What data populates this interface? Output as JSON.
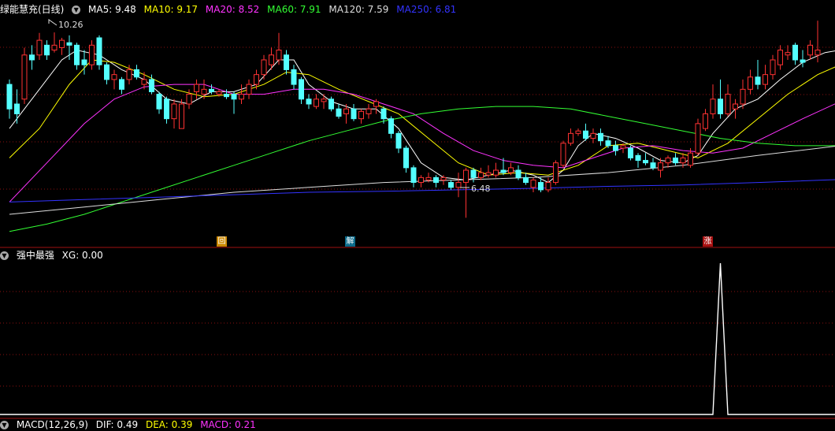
{
  "header": {
    "stock_name": "绿能慧充(日线)",
    "ma": [
      {
        "label": "MA5: 9.48",
        "color": "#ffffff"
      },
      {
        "label": "MA10: 9.17",
        "color": "#ffff00"
      },
      {
        "label": "MA20: 8.52",
        "color": "#ff33ff"
      },
      {
        "label": "MA60: 7.91",
        "color": "#33ff33"
      },
      {
        "label": "MA120: 7.59",
        "color": "#dddddd"
      },
      {
        "label": "MA250: 6.81",
        "color": "#3333ff"
      }
    ]
  },
  "markers": {
    "hui": "回",
    "jie": "解",
    "zhang": "涨"
  },
  "indicator": {
    "title": "强中最强",
    "xg_label": "XG: 0.00"
  },
  "macd": {
    "title": "MACD(12,26,9)",
    "dif": "DIF: 0.49",
    "dea": "DEA: 0.39",
    "macd": "MACD: 0.21"
  },
  "chart_data": {
    "type": "candlestick",
    "price_range": [
      6.1,
      10.6
    ],
    "annotations": {
      "high": "10.26",
      "low": "6.48"
    },
    "candles": [
      [
        9.2,
        8.7,
        9.3,
        8.5
      ],
      [
        8.8,
        8.6,
        9.1,
        8.4
      ],
      [
        8.9,
        9.8,
        9.95,
        8.8
      ],
      [
        9.8,
        9.7,
        10.0,
        9.5
      ],
      [
        9.8,
        10.1,
        10.25,
        9.7
      ],
      [
        10.0,
        9.8,
        10.1,
        9.7
      ],
      [
        9.9,
        10.0,
        10.26,
        9.85
      ],
      [
        9.95,
        10.1,
        10.15,
        9.8
      ],
      [
        10.05,
        10.0,
        10.2,
        9.7
      ],
      [
        10.0,
        9.6,
        10.05,
        9.5
      ],
      [
        9.7,
        9.6,
        9.9,
        9.4
      ],
      [
        9.6,
        10.0,
        10.1,
        9.5
      ],
      [
        10.15,
        9.6,
        10.2,
        9.5
      ],
      [
        9.6,
        9.3,
        9.65,
        9.2
      ],
      [
        9.3,
        9.4,
        9.5,
        9.1
      ],
      [
        9.3,
        9.1,
        9.35,
        9.0
      ],
      [
        9.3,
        9.5,
        9.6,
        9.2
      ],
      [
        9.5,
        9.35,
        9.6,
        9.3
      ],
      [
        9.2,
        9.3,
        9.45,
        9.1
      ],
      [
        9.3,
        9.05,
        9.4,
        9.0
      ],
      [
        9.0,
        8.7,
        9.05,
        8.6
      ],
      [
        8.9,
        8.5,
        8.95,
        8.4
      ],
      [
        8.5,
        8.8,
        8.9,
        8.3
      ],
      [
        8.3,
        8.8,
        8.9,
        8.3
      ],
      [
        8.8,
        9.0,
        9.1,
        8.7
      ],
      [
        9.05,
        9.2,
        9.3,
        8.9
      ],
      [
        9.0,
        9.1,
        9.3,
        8.9
      ],
      [
        9.1,
        9.05,
        9.2,
        9.0
      ],
      [
        9.0,
        9.05,
        9.1,
        8.95
      ],
      [
        9.0,
        8.95,
        9.1,
        8.9
      ],
      [
        9.0,
        8.9,
        9.05,
        8.6
      ],
      [
        8.9,
        9.0,
        9.2,
        8.8
      ],
      [
        9.0,
        9.2,
        9.3,
        8.9
      ],
      [
        9.2,
        9.4,
        9.5,
        9.1
      ],
      [
        9.4,
        9.7,
        9.8,
        9.3
      ],
      [
        9.6,
        9.8,
        9.95,
        9.5
      ],
      [
        9.7,
        9.9,
        10.25,
        9.6
      ],
      [
        9.8,
        9.5,
        9.9,
        9.4
      ],
      [
        9.5,
        9.2,
        9.6,
        9.1
      ],
      [
        9.3,
        8.9,
        9.35,
        8.8
      ],
      [
        8.9,
        8.8,
        9.0,
        8.7
      ],
      [
        8.75,
        8.9,
        9.0,
        8.7
      ],
      [
        8.85,
        8.9,
        9.0,
        8.7
      ],
      [
        8.9,
        8.7,
        8.95,
        8.65
      ],
      [
        8.7,
        8.55,
        8.8,
        8.5
      ],
      [
        8.6,
        8.7,
        8.8,
        8.4
      ],
      [
        8.7,
        8.5,
        8.8,
        8.45
      ],
      [
        8.5,
        8.65,
        8.7,
        8.4
      ],
      [
        8.6,
        8.7,
        8.8,
        8.5
      ],
      [
        8.75,
        8.85,
        8.9,
        8.6
      ],
      [
        8.7,
        8.5,
        8.75,
        8.4
      ],
      [
        8.5,
        8.2,
        8.55,
        8.1
      ],
      [
        8.2,
        7.9,
        8.25,
        7.8
      ],
      [
        7.9,
        7.5,
        7.95,
        7.4
      ],
      [
        7.5,
        7.2,
        7.55,
        7.1
      ],
      [
        7.2,
        7.3,
        7.35,
        7.1
      ],
      [
        7.25,
        7.3,
        7.4,
        7.2
      ],
      [
        7.3,
        7.2,
        7.35,
        7.1
      ],
      [
        7.25,
        7.3,
        7.35,
        7.15
      ],
      [
        7.2,
        7.1,
        7.25,
        7.05
      ],
      [
        7.1,
        7.2,
        7.4,
        6.9
      ],
      [
        7.2,
        7.45,
        7.5,
        6.48
      ],
      [
        7.45,
        7.3,
        7.5,
        7.2
      ],
      [
        7.3,
        7.4,
        7.5,
        7.25
      ],
      [
        7.35,
        7.4,
        7.55,
        7.3
      ],
      [
        7.35,
        7.45,
        7.6,
        7.3
      ],
      [
        7.45,
        7.4,
        7.7,
        7.35
      ],
      [
        7.4,
        7.5,
        7.6,
        7.35
      ],
      [
        7.45,
        7.3,
        7.55,
        7.25
      ],
      [
        7.3,
        7.2,
        7.4,
        7.15
      ],
      [
        7.1,
        7.25,
        7.3,
        7.0
      ],
      [
        7.2,
        7.05,
        7.3,
        7.0
      ],
      [
        7.05,
        7.2,
        7.3,
        7.0
      ],
      [
        7.2,
        7.6,
        7.65,
        7.15
      ],
      [
        7.55,
        8.0,
        8.05,
        7.5
      ],
      [
        8.0,
        8.2,
        8.3,
        7.95
      ],
      [
        8.2,
        8.25,
        8.3,
        8.15
      ],
      [
        8.25,
        8.1,
        8.4,
        8.05
      ],
      [
        8.1,
        8.2,
        8.3,
        8.0
      ],
      [
        8.2,
        8.05,
        8.3,
        7.95
      ],
      [
        8.05,
        7.95,
        8.15,
        7.9
      ],
      [
        7.95,
        7.85,
        8.05,
        7.75
      ],
      [
        7.9,
        7.95,
        8.0,
        7.8
      ],
      [
        7.9,
        7.7,
        7.95,
        7.65
      ],
      [
        7.75,
        7.65,
        7.8,
        7.5
      ],
      [
        7.65,
        7.6,
        7.8,
        7.55
      ],
      [
        7.6,
        7.5,
        7.7,
        7.45
      ],
      [
        7.45,
        7.6,
        7.7,
        7.3
      ],
      [
        7.6,
        7.7,
        7.75,
        7.5
      ],
      [
        7.7,
        7.6,
        7.8,
        7.55
      ],
      [
        7.6,
        7.7,
        7.8,
        7.5
      ],
      [
        7.55,
        7.8,
        7.9,
        7.5
      ],
      [
        7.8,
        8.4,
        8.5,
        7.75
      ],
      [
        8.3,
        8.6,
        8.7,
        8.25
      ],
      [
        8.6,
        8.9,
        9.2,
        8.5
      ],
      [
        8.9,
        8.6,
        9.3,
        8.5
      ],
      [
        8.6,
        9.0,
        9.2,
        8.55
      ],
      [
        8.7,
        8.8,
        8.9,
        8.5
      ],
      [
        8.8,
        9.1,
        9.3,
        8.7
      ],
      [
        9.1,
        9.35,
        9.5,
        9.0
      ],
      [
        9.35,
        9.2,
        9.7,
        9.1
      ],
      [
        9.2,
        9.4,
        9.6,
        9.1
      ],
      [
        9.4,
        9.7,
        9.8,
        9.3
      ],
      [
        9.6,
        9.9,
        10.0,
        9.5
      ],
      [
        9.8,
        9.85,
        10.0,
        9.7
      ],
      [
        10.0,
        9.7,
        10.05,
        9.6
      ],
      [
        9.7,
        9.65,
        9.9,
        9.55
      ],
      [
        9.8,
        10.0,
        10.1,
        9.7
      ],
      [
        9.8,
        9.9,
        10.5,
        9.65
      ]
    ],
    "ma_lines": [
      {
        "name": "MA5",
        "color": "#ffffff",
        "points": [
          [
            0,
            8.3
          ],
          [
            3,
            8.9
          ],
          [
            7,
            9.7
          ],
          [
            9,
            9.9
          ],
          [
            12,
            9.8
          ],
          [
            15,
            9.5
          ],
          [
            18,
            9.3
          ],
          [
            21,
            8.9
          ],
          [
            24,
            8.8
          ],
          [
            27,
            9.05
          ],
          [
            30,
            9.05
          ],
          [
            33,
            9.2
          ],
          [
            36,
            9.7
          ],
          [
            38,
            9.7
          ],
          [
            40,
            9.2
          ],
          [
            43,
            8.85
          ],
          [
            46,
            8.7
          ],
          [
            49,
            8.7
          ],
          [
            52,
            8.3
          ],
          [
            55,
            7.6
          ],
          [
            58,
            7.3
          ],
          [
            61,
            7.25
          ],
          [
            64,
            7.35
          ],
          [
            67,
            7.45
          ],
          [
            70,
            7.35
          ],
          [
            72,
            7.2
          ],
          [
            74,
            7.45
          ],
          [
            76,
            7.95
          ],
          [
            78,
            8.2
          ],
          [
            81,
            8.1
          ],
          [
            84,
            7.9
          ],
          [
            87,
            7.65
          ],
          [
            90,
            7.6
          ],
          [
            92,
            7.75
          ],
          [
            94,
            8.2
          ],
          [
            97,
            8.7
          ],
          [
            100,
            8.9
          ],
          [
            103,
            9.3
          ],
          [
            106,
            9.65
          ],
          [
            109,
            9.85
          ],
          [
            111,
            9.9
          ]
        ]
      },
      {
        "name": "MA10",
        "color": "#ffff00",
        "points": [
          [
            0,
            7.7
          ],
          [
            4,
            8.3
          ],
          [
            8,
            9.2
          ],
          [
            11,
            9.7
          ],
          [
            14,
            9.65
          ],
          [
            18,
            9.4
          ],
          [
            22,
            9.1
          ],
          [
            26,
            8.95
          ],
          [
            30,
            9.0
          ],
          [
            34,
            9.2
          ],
          [
            37,
            9.45
          ],
          [
            40,
            9.4
          ],
          [
            44,
            9.1
          ],
          [
            48,
            8.85
          ],
          [
            52,
            8.6
          ],
          [
            56,
            8.1
          ],
          [
            60,
            7.6
          ],
          [
            64,
            7.35
          ],
          [
            68,
            7.4
          ],
          [
            72,
            7.35
          ],
          [
            76,
            7.55
          ],
          [
            80,
            7.95
          ],
          [
            84,
            8.0
          ],
          [
            88,
            7.85
          ],
          [
            92,
            7.7
          ],
          [
            96,
            8.0
          ],
          [
            100,
            8.5
          ],
          [
            104,
            9.0
          ],
          [
            108,
            9.4
          ],
          [
            111,
            9.6
          ]
        ]
      },
      {
        "name": "MA20",
        "color": "#ff33ff",
        "points": [
          [
            0,
            6.8
          ],
          [
            5,
            7.6
          ],
          [
            10,
            8.4
          ],
          [
            14,
            8.9
          ],
          [
            18,
            9.15
          ],
          [
            22,
            9.2
          ],
          [
            26,
            9.2
          ],
          [
            30,
            9.0
          ],
          [
            34,
            9.0
          ],
          [
            38,
            9.1
          ],
          [
            42,
            9.1
          ],
          [
            46,
            9.0
          ],
          [
            50,
            8.8
          ],
          [
            54,
            8.6
          ],
          [
            58,
            8.2
          ],
          [
            62,
            7.85
          ],
          [
            66,
            7.65
          ],
          [
            70,
            7.55
          ],
          [
            74,
            7.5
          ],
          [
            78,
            7.7
          ],
          [
            82,
            7.9
          ],
          [
            86,
            7.95
          ],
          [
            90,
            7.85
          ],
          [
            94,
            7.8
          ],
          [
            98,
            7.9
          ],
          [
            102,
            8.2
          ],
          [
            106,
            8.5
          ],
          [
            111,
            8.85
          ]
        ]
      },
      {
        "name": "MA60",
        "color": "#33ff33",
        "points": [
          [
            0,
            6.2
          ],
          [
            5,
            6.35
          ],
          [
            10,
            6.55
          ],
          [
            15,
            6.8
          ],
          [
            20,
            7.05
          ],
          [
            25,
            7.3
          ],
          [
            30,
            7.55
          ],
          [
            35,
            7.8
          ],
          [
            40,
            8.05
          ],
          [
            45,
            8.25
          ],
          [
            50,
            8.45
          ],
          [
            55,
            8.6
          ],
          [
            60,
            8.7
          ],
          [
            65,
            8.75
          ],
          [
            70,
            8.75
          ],
          [
            75,
            8.7
          ],
          [
            80,
            8.55
          ],
          [
            85,
            8.4
          ],
          [
            90,
            8.25
          ],
          [
            95,
            8.1
          ],
          [
            100,
            8.0
          ],
          [
            105,
            7.95
          ],
          [
            111,
            7.95
          ]
        ]
      },
      {
        "name": "MA120",
        "color": "#dddddd",
        "points": [
          [
            0,
            6.55
          ],
          [
            10,
            6.7
          ],
          [
            20,
            6.85
          ],
          [
            30,
            7.0
          ],
          [
            40,
            7.1
          ],
          [
            50,
            7.2
          ],
          [
            60,
            7.25
          ],
          [
            70,
            7.3
          ],
          [
            80,
            7.4
          ],
          [
            90,
            7.55
          ],
          [
            100,
            7.75
          ],
          [
            111,
            7.95
          ]
        ]
      },
      {
        "name": "MA250",
        "color": "#3333ff",
        "points": [
          [
            0,
            6.8
          ],
          [
            10,
            6.85
          ],
          [
            20,
            6.9
          ],
          [
            30,
            6.95
          ],
          [
            40,
            7.0
          ],
          [
            50,
            7.02
          ],
          [
            60,
            7.05
          ],
          [
            70,
            7.08
          ],
          [
            80,
            7.12
          ],
          [
            90,
            7.15
          ],
          [
            100,
            7.2
          ],
          [
            111,
            7.26
          ]
        ]
      }
    ],
    "xg_signal": {
      "peak_index": 95,
      "peak_value": 1,
      "baseline": 0
    }
  }
}
